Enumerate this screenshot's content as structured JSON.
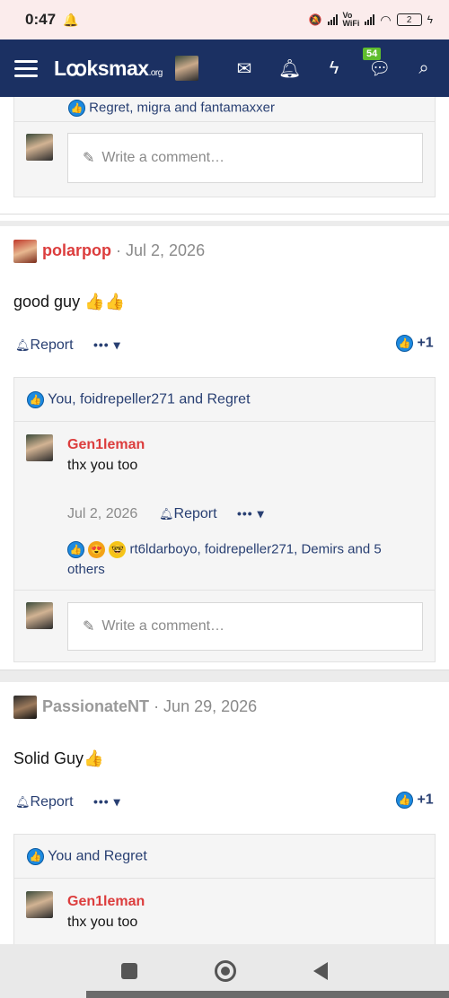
{
  "status_bar": {
    "time": "0:47",
    "net1": "Vo\nWiFi",
    "battery": "2"
  },
  "nav": {
    "logo": "Lꝏksmax",
    "logo_suffix": ".org",
    "chat_badge": "54"
  },
  "top_fragment": {
    "reactions": "Regret, migra and fantamaxxer",
    "comment_placeholder": "Write a comment…"
  },
  "posts": [
    {
      "author": "polarpop",
      "date": "· Jul 2, 2026",
      "body": "good guy 👍👍",
      "report": "Report",
      "score": "+1",
      "reactions": "You, foidrepeller271 and Regret",
      "reply": {
        "author": "Gen1leman",
        "body": "thx you too",
        "date": "Jul 2, 2026",
        "report": "Report",
        "reactions_line1": "rt6ldarboyo, foidrepeller271, Demirs and 5",
        "reactions_line2": "others"
      },
      "comment_placeholder": "Write a comment…"
    },
    {
      "author": "PassionateNT",
      "date": "· Jun 29, 2026",
      "body": "Solid Guy👍",
      "report": "Report",
      "score": "+1",
      "reactions": "You and Regret",
      "reply": {
        "author": "Gen1leman",
        "body": "thx you too"
      }
    }
  ]
}
